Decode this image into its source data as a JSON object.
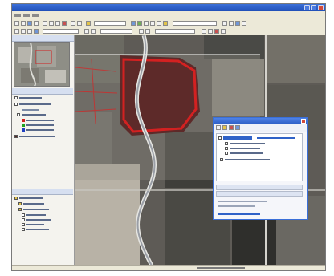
{
  "icons": {
    "overview_thumbnail": "overview-map-thumbnail",
    "dialog_close": "close-icon",
    "window_controls": [
      "minimize-icon",
      "maximize-icon",
      "close-icon"
    ]
  },
  "colors": {
    "title_bar": "#2a5cc4",
    "chrome": "#ece9d8",
    "selection": "#2f62c8",
    "highlight_overlay": "#e02020"
  }
}
